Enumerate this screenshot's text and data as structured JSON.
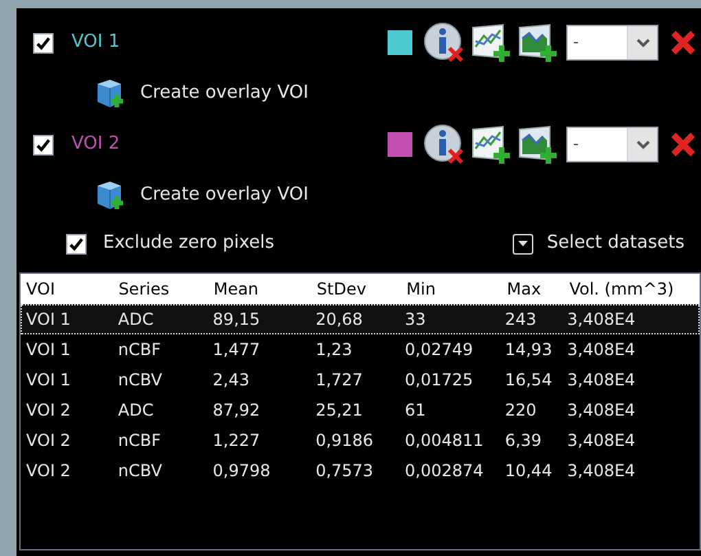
{
  "vois": [
    {
      "name": "VOI 1",
      "checked": true,
      "color": "#4ec9d2",
      "dropdown": {
        "value": "-"
      },
      "overlay_action": "Create overlay VOI"
    },
    {
      "name": "VOI 2",
      "checked": true,
      "color": "#c04fb0",
      "dropdown": {
        "value": "-"
      },
      "overlay_action": "Create overlay VOI"
    }
  ],
  "exclude_zero": {
    "label": "Exclude zero pixels",
    "checked": true
  },
  "select_datasets": {
    "label": "Select datasets"
  },
  "table": {
    "columns": [
      "VOI",
      "Series",
      "Mean",
      "StDev",
      "Min",
      "Max",
      "Vol. (mm^3)"
    ],
    "rows": [
      {
        "cells": [
          "VOI 1",
          "ADC",
          "89,15",
          "20,68",
          "33",
          "243",
          "3,408E4"
        ],
        "selected": true
      },
      {
        "cells": [
          "VOI 1",
          "nCBF",
          "1,477",
          "1,23",
          "0,02749",
          "14,93",
          "3,408E4"
        ],
        "selected": false
      },
      {
        "cells": [
          "VOI 1",
          "nCBV",
          "2,43",
          "1,727",
          "0,01725",
          "16,54",
          "3,408E4"
        ],
        "selected": false
      },
      {
        "cells": [
          "VOI 2",
          "ADC",
          "87,92",
          "25,21",
          "61",
          "220",
          "3,408E4"
        ],
        "selected": false
      },
      {
        "cells": [
          "VOI 2",
          "nCBF",
          "1,227",
          "0,9186",
          "0,004811",
          "6,39",
          "3,408E4"
        ],
        "selected": false
      },
      {
        "cells": [
          "VOI 2",
          "nCBV",
          "0,9798",
          "0,7573",
          "0,002874",
          "10,44",
          "3,408E4"
        ],
        "selected": false
      }
    ]
  }
}
